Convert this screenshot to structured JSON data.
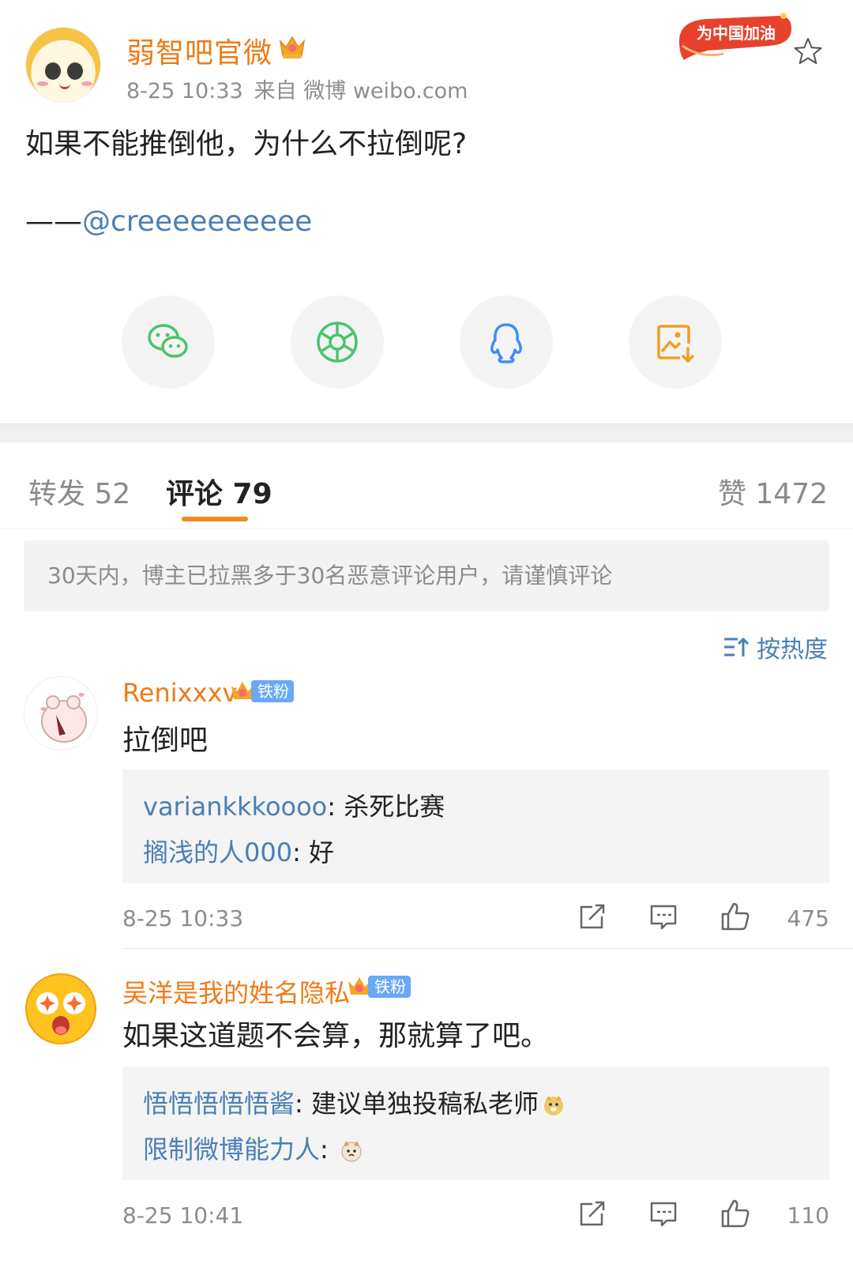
{
  "post": {
    "author": "弱智吧官微",
    "time": "8-25 10:33",
    "source": "来自 微博 weibo.com",
    "badge_text": "为中国加油",
    "text": "如果不能推倒他，为什么不拉倒呢?",
    "signature_dash": "——",
    "signature_mention": "@creeeeeeeeee"
  },
  "share": [
    "wechat-icon",
    "moments-icon",
    "qq-icon",
    "save-image-icon"
  ],
  "colors": {
    "accent": "#f07a16",
    "link": "#4a7fb5",
    "tab_underline": "#f28a1c",
    "fan_badge": "#6aa9f5"
  },
  "tabs": {
    "repost": "转发 52",
    "comments": "评论 79",
    "likes": "赞 1472"
  },
  "notice": "30天内，博主已拉黑多于30名恶意评论用户，请谨慎评论",
  "sort_label": "按热度",
  "comments": [
    {
      "name": "Renixxxv",
      "fan_label": "铁粉",
      "text": "拉倒吧",
      "replies": [
        {
          "who": "variankkkoooo",
          "sep": ": ",
          "text": "杀死比赛"
        },
        {
          "who": "搁浅的人000",
          "sep": ": ",
          "text": "好"
        }
      ],
      "time": "8-25 10:33",
      "likes": "475"
    },
    {
      "name": "吴洋是我的姓名隐私",
      "fan_label": "铁粉",
      "text": "如果这道题不会算，那就算了吧。",
      "replies": [
        {
          "who": "悟悟悟悟悟酱",
          "sep": ": ",
          "text": "建议单独投稿私老师"
        },
        {
          "who": "限制微博能力人",
          "sep": ": ",
          "text": ""
        }
      ],
      "time": "8-25 10:41",
      "likes": "110"
    }
  ]
}
